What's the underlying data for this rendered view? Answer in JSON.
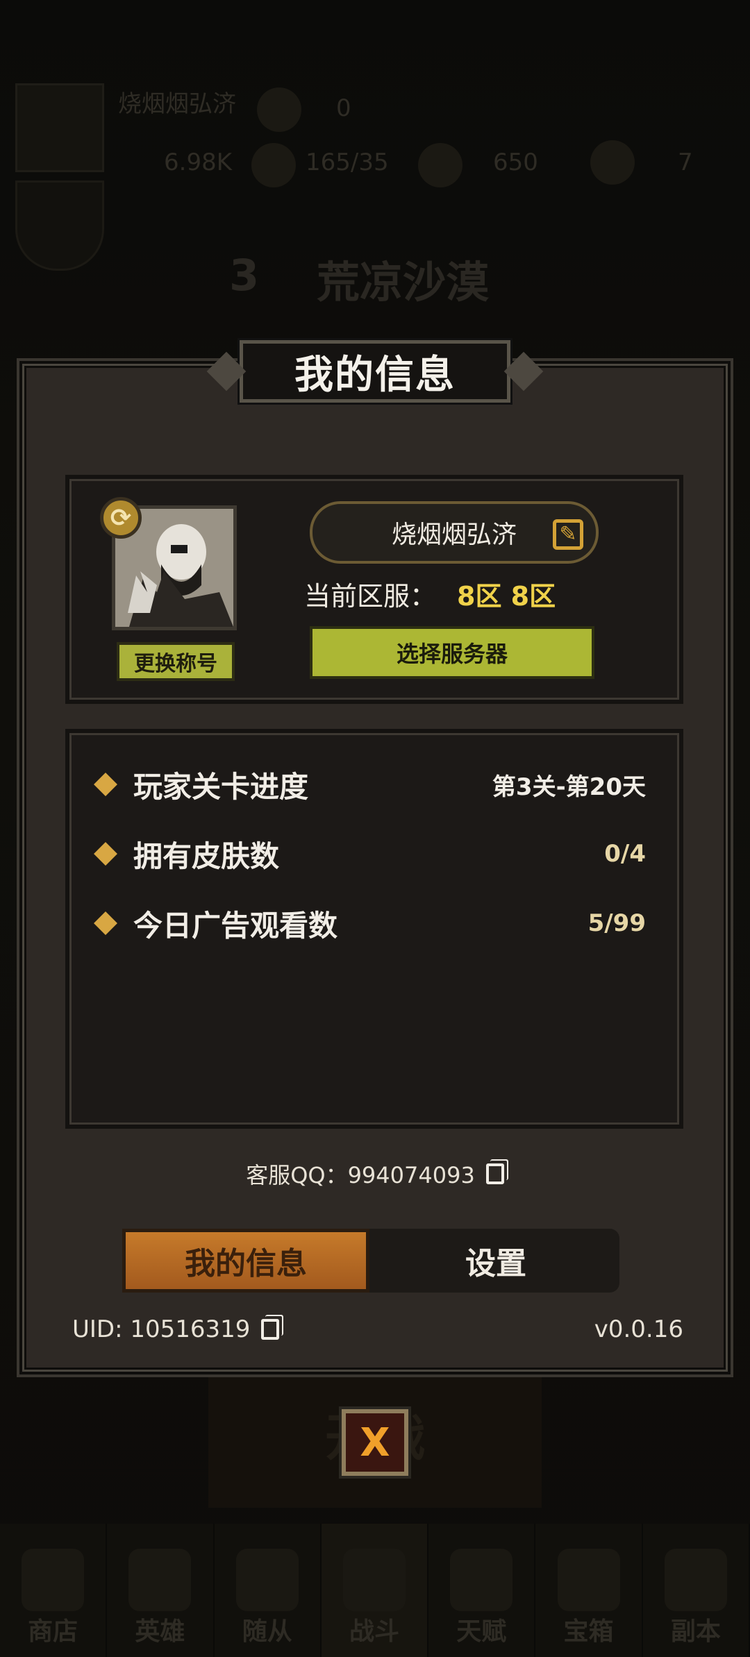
{
  "background": {
    "player_name": "烧烟烟弘济",
    "stat_1": "0",
    "stat_2": "6.98K",
    "stat_3": "165/35",
    "stat_4": "650",
    "stat_5": "7",
    "chapter_number": "3",
    "chapter_name": "荒凉沙漠",
    "start_label": "开战",
    "nav": [
      "商店",
      "英雄",
      "随从",
      "战斗",
      "天赋",
      "宝箱",
      "副本"
    ]
  },
  "modal": {
    "title": "我的信息",
    "profile": {
      "name": "烧烟烟弘济",
      "server_label": "当前区服：",
      "server_value": "8区 8区",
      "select_server_label": "选择服务器",
      "change_title_label": "更换称号"
    },
    "stats": [
      {
        "label": "玩家关卡进度",
        "value": "第3关-第20天"
      },
      {
        "label": "拥有皮肤数",
        "value": "0/4"
      },
      {
        "label": "今日广告观看数",
        "value": "5/99"
      }
    ],
    "qq": "客服QQ：994074093",
    "tabs": {
      "info": "我的信息",
      "settings": "设置"
    },
    "uid": "UID: 10516319",
    "version": "v0.0.16",
    "close": "X"
  },
  "colors": {
    "accent_gold": "#d8a743",
    "button_green": "#acb734",
    "tab_active": "#c67a2a",
    "panel_bg": "#1c1917",
    "modal_bg": "#2e2925"
  }
}
